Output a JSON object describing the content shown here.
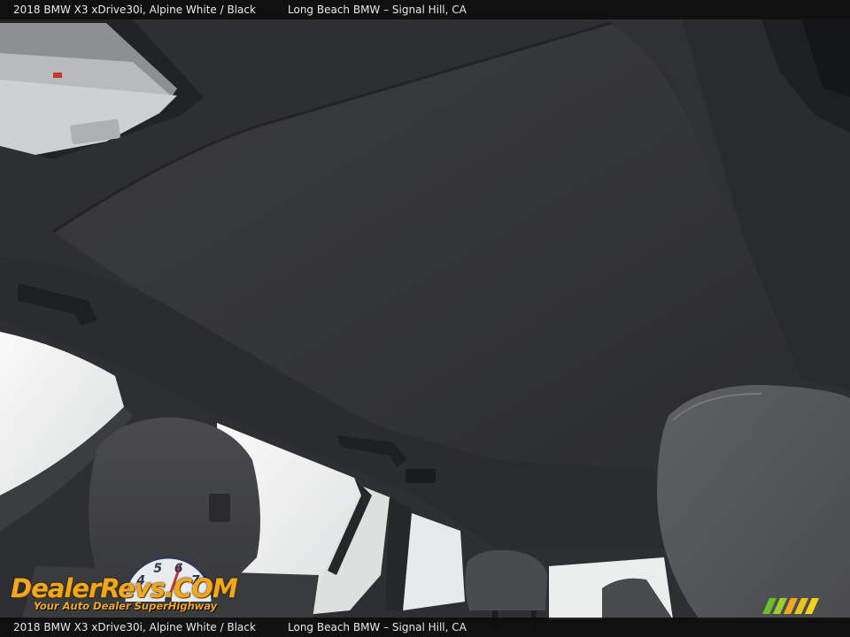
{
  "caption": {
    "top_left": "2018 BMW X3 xDrive30i,  Alpine White / Black",
    "top_right": "Long Beach BMW – Signal Hill, CA",
    "bottom_left": "2018 BMW X3 xDrive30i,  Alpine White / Black",
    "bottom_right": "Long Beach BMW – Signal Hill, CA"
  },
  "watermark": {
    "brand_part1": "DealerRevs",
    "brand_part2": ".COM",
    "tagline": "Your Auto Dealer SuperHighway",
    "gauge_digits": [
      "4",
      "5",
      "6",
      "7"
    ]
  },
  "colors": {
    "caption_bg": "#0c0c0c",
    "logo_orange": "#f2a81d",
    "logo_blue": "#3b7fd6",
    "headliner": "#2f3032",
    "sunshade": "#343537"
  }
}
